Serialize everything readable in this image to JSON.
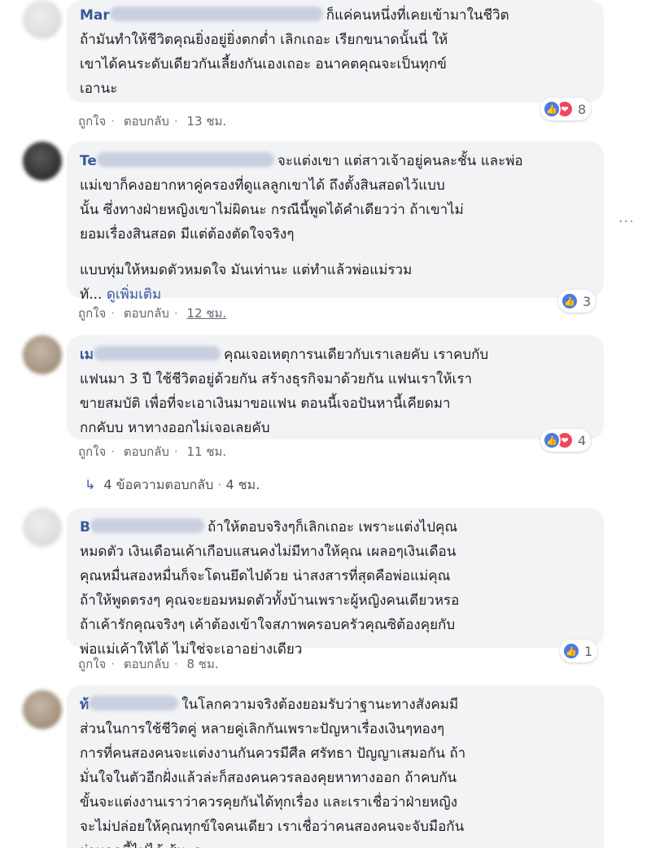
{
  "comments": [
    {
      "name_prefix": "Mar",
      "text_first": "ก็แค่คนหนึ่งที่เคยเข้ามาในชีวิต",
      "lines": [
        "ถ้ามันทำให้ชีวิตคุณยิ่งอยู่ยิ่งตกต่ำ เลิกเถอะ เรียกขนาดนั้นนี่ ให้",
        "เขาได้คนระดับเดียวกันเลี้ยงกันเองเถอะ อนาคตคุณจะเป็นทุกข์",
        "เอานะ"
      ],
      "like_label": "ถูกใจ",
      "reply_label": "ตอบกลับ",
      "time": "13 ชม.",
      "reaction_count": "8"
    },
    {
      "name_prefix": "Te",
      "text_first": "จะแต่งเขา แต่สาวเจ้าอยู่คนละชั้น และพ่อ",
      "lines": [
        "แม่เขาก็คงอยากหาคู่ครองที่ดูแลลูกเขาได้ ถึงตั้งสินสอดไว้แบบ",
        "นั้น ซึ่งทางฝ่ายหญิงเขาไม่ผิดนะ กรณีนี้พูดได้คำเดียวว่า ถ้าเขาไม่",
        "ยอมเรื่องสินสอด มีแต่ต้องตัดใจจริงๆ"
      ],
      "para2_line1": "แบบทุ่มให้หมดตัวหมดใจ มันเท่านะ แต่ทำแล้วพ่อแม่รวม",
      "para2_line2": "ทั...",
      "see_more": "ดูเพิ่มเติม",
      "like_label": "ถูกใจ",
      "reply_label": "ตอบกลับ",
      "time": "12 ชม.",
      "reaction_count": "3"
    },
    {
      "name_prefix": "เม",
      "text_first": "คุณเจอเหตุการนเดียวกับเราเลยคับ เราคบกับ",
      "lines": [
        "แฟนมา 3 ปี ใช้ชีวิตอยู่ด้วยกัน สร้างธุรกิจมาด้วยกัน แฟนเราให้เรา",
        "ขายสมบัติ เพื่อที่จะเอาเงินมาขอแฟน ตอนนี้เจอปันหานี้เคียดมา",
        "กกคับบ หาทางออกไม่เจอเลยคับ"
      ],
      "like_label": "ถูกใจ",
      "reply_label": "ตอบกลับ",
      "time": "11 ชม.",
      "reaction_count": "4",
      "replies_label": "4 ข้อความตอบกลับ",
      "replies_time": "4 ชม."
    },
    {
      "name_prefix": "B",
      "text_first": "ถ้าให้ตอบจริงๆก็เลิกเถอะ เพราะแต่งไปคุณ",
      "lines": [
        "หมดตัว เงินเดือนเค้าเกือบแสนคงไม่มีทางให้คุณ เผลอๆเงินเดือน",
        "คุณหมื่นสองหมื่นก็จะโดนยึดไปด้วย น่าสงสารที่สุดคือพ่อแม่คุณ",
        "ถ้าให้พูดตรงๆ คุณจะยอมหมดตัวทั้งบ้านเพราะผู้หญิงคนเดียวหรอ",
        "ถ้าเค้ารักคุณจริงๆ เค้าต้องเข้าใจสภาพครอบครัวคุณซิต้องคุยกับ",
        "พ่อแม่เค้าให้ได้ ไม่ใช่จะเอาอย่างเดียว"
      ],
      "like_label": "ถูกใจ",
      "reply_label": "ตอบกลับ",
      "time": "8 ชม.",
      "reaction_count": "1"
    },
    {
      "name_prefix": "ท้",
      "text_first": "ในโลกความจริงต้องยอมรับว่าฐานะทางสังคมมี",
      "lines": [
        "ส่วนในการใช้ชีวิตคู่ หลายคู่เลิกกันเพราะปัญหาเรื่องเงินๆทองๆ",
        "การที่คนสองคนจะแต่งงานกันควรมีศีล ศรัทธา ปัญญาเสมอกัน ถ้า",
        "มั่นใจในตัวอีกฝั่งแล้วล่ะก็สองคนควรลองคุยหาทางออก ถ้าคบกัน",
        "ขั้นจะแต่งงานเราว่าควรคุยกันได้ทุกเรื่อง และเราเชื่อว่าฝ่ายหญิง",
        "จะไม่ปล่อยให้คุณทุกข์ใจคนเดียว เราเชื่อว่าคนสองคนจะจับมือกัน",
        "ผ่านจุดนี้ไปได้ สู้นะคะ"
      ]
    }
  ],
  "colors": {
    "like": "#4c79e3",
    "love": "#f0465f",
    "name": "#385898",
    "bubble": "#f2f3f5"
  }
}
